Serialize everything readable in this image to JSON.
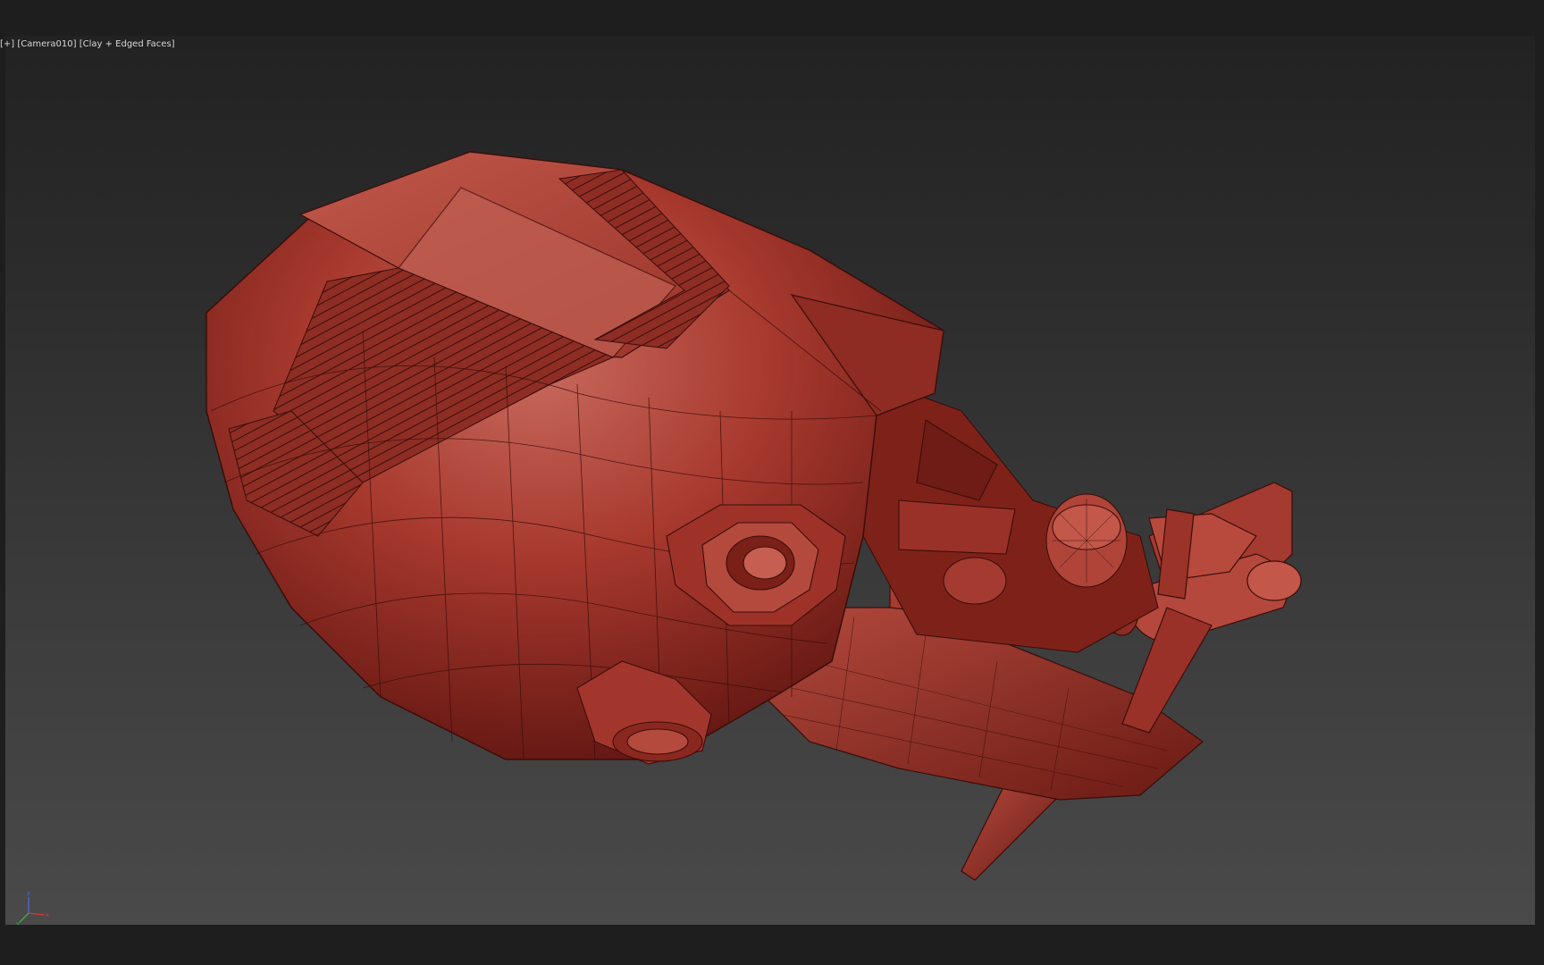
{
  "viewport": {
    "menu_label": "[+]",
    "camera_label": "[Camera010]",
    "shading_label": "[Clay + Edged Faces]"
  },
  "axis_gizmo": {
    "z": "z",
    "x": "x",
    "y": "y",
    "colors": {
      "x": "#d23a3a",
      "y": "#3fae3f",
      "z": "#4a6ae0"
    }
  },
  "model": {
    "material_color": "#b84a3e",
    "wire_color": "#3a0d0a"
  }
}
